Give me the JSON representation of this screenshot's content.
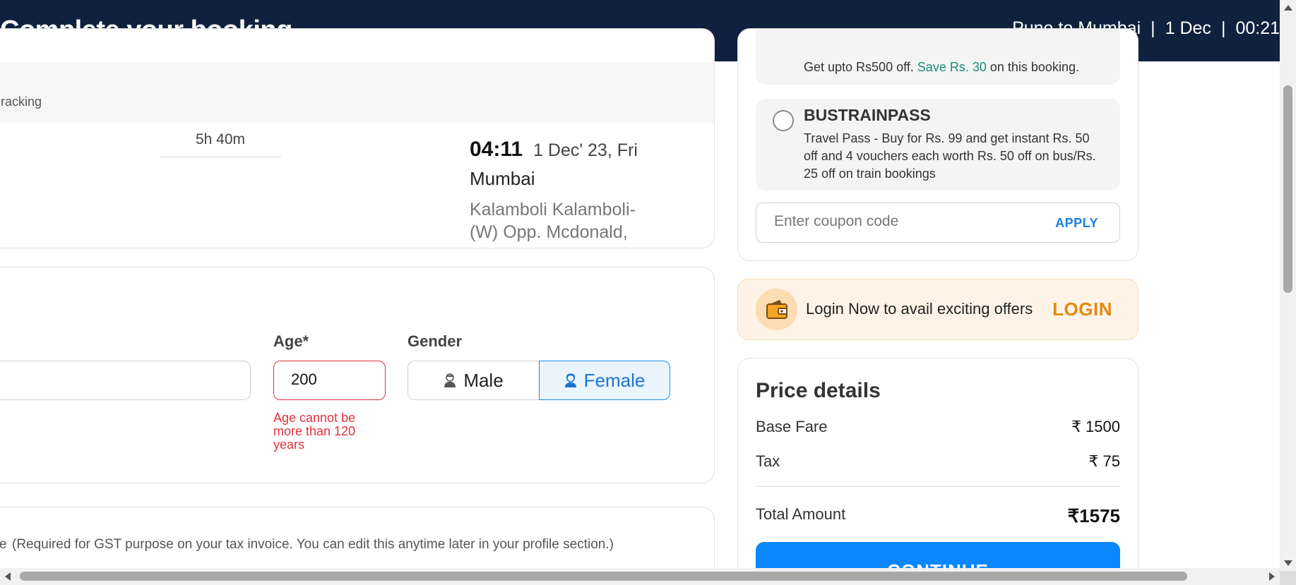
{
  "header": {
    "title": "Complete your booking",
    "route": "Pune to Mumbai",
    "date": "1 Dec",
    "time": "00:21"
  },
  "journey": {
    "tracking_text": "racking",
    "duration": "5h 40m",
    "arrival_time": "04:11",
    "arrival_date": "1 Dec' 23, Fri",
    "arrival_city": "Mumbai",
    "arrival_stop": "Kalamboli Kalamboli-(W) Opp. Mcdonald, Highway"
  },
  "traveller": {
    "age_label": "Age*",
    "age_value": "200",
    "age_error": "Age cannot be more than 120 years",
    "gender_label": "Gender",
    "gender_male": "Male",
    "gender_female": "Female",
    "gender_selected": "Female"
  },
  "gst": {
    "mark": "e",
    "note": "(Required for GST purpose on your tax invoice. You can edit this anytime later in your profile section.)"
  },
  "offers": {
    "top_offer_prefix": "Get upto Rs500 off.",
    "top_offer_save": "Save Rs. 30",
    "top_offer_suffix": "on this booking.",
    "coupon_code": "BUSTRAINPASS",
    "coupon_desc": "Travel Pass - Buy for Rs. 99 and get instant Rs. 50 off and 4 vouchers each worth Rs. 50 off on bus/Rs. 25 off on train bookings",
    "coupon_placeholder": "Enter coupon code",
    "apply_label": "APPLY"
  },
  "login_banner": {
    "text": "Login Now to avail exciting offers",
    "button": "LOGIN",
    "icon": "wallet-icon"
  },
  "price": {
    "title": "Price details",
    "base_fare_label": "Base Fare",
    "base_fare_value": "₹ 1500",
    "tax_label": "Tax",
    "tax_value": "₹ 75",
    "total_label": "Total Amount",
    "total_value": "₹1575",
    "continue_label": "CONTINUE"
  },
  "colors": {
    "header_bg": "#10213f",
    "accent_blue": "#0a87ff",
    "error_red": "#e0313b",
    "login_orange": "#e08a10",
    "save_green": "#1a8a7a"
  }
}
